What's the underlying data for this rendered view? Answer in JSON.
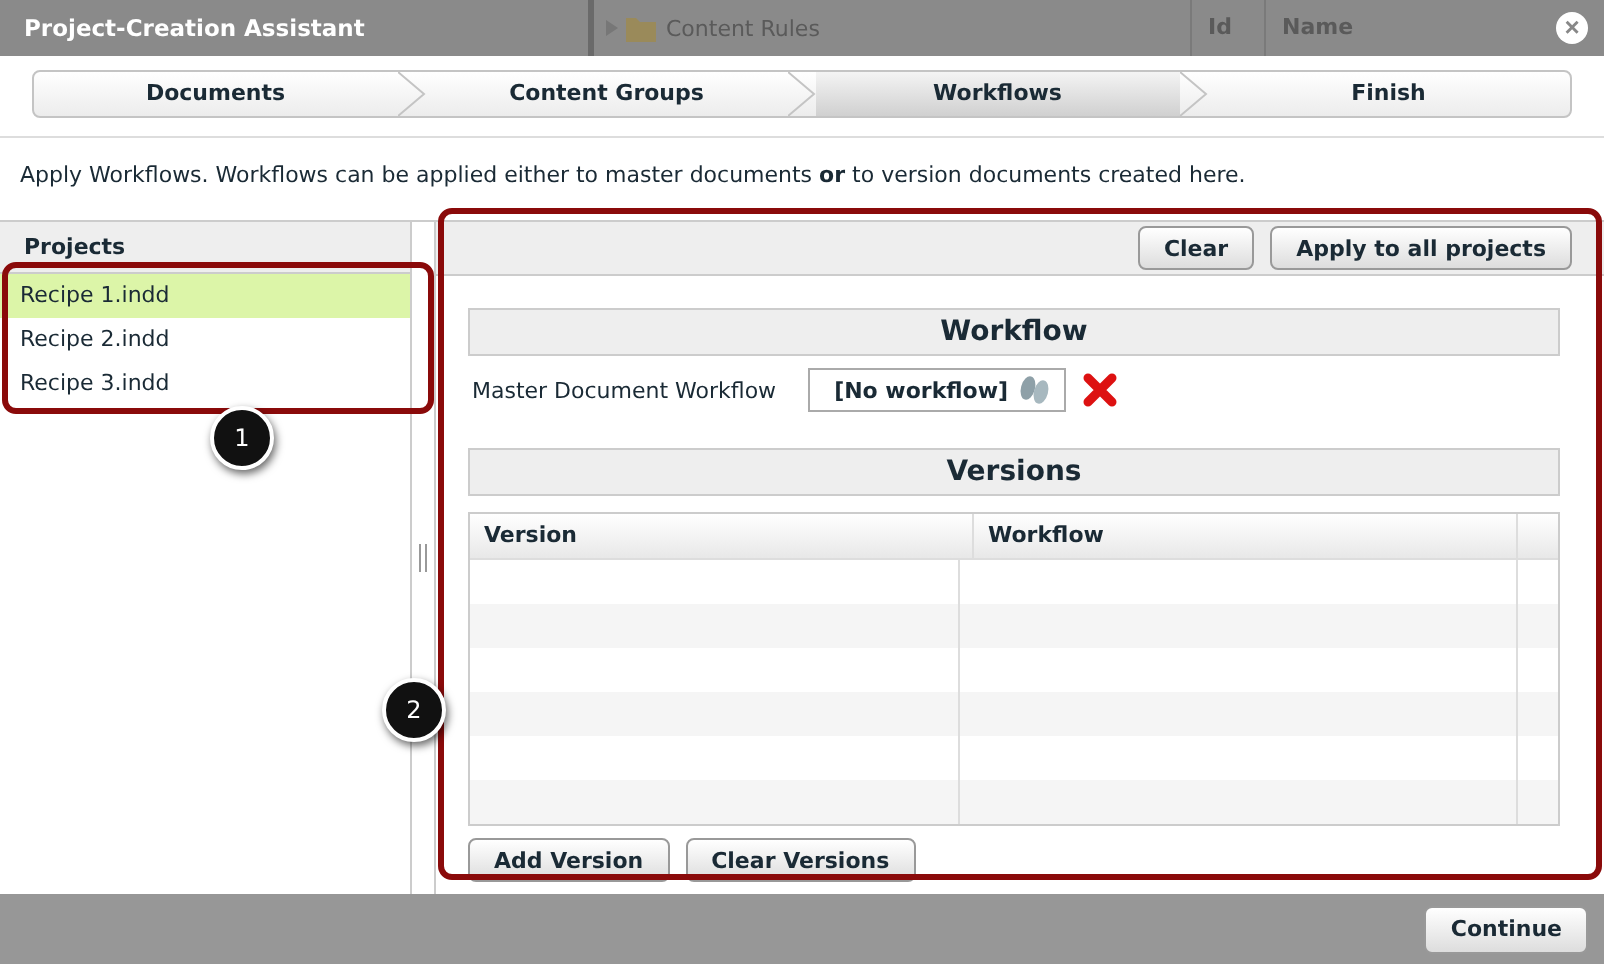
{
  "background_page": {
    "folder": "Content Rules",
    "columns": [
      "Id",
      "Name"
    ]
  },
  "window": {
    "title": "Project-Creation Assistant",
    "close": "×"
  },
  "steps": [
    {
      "label": "Documents",
      "selected": false
    },
    {
      "label": "Content Groups",
      "selected": false
    },
    {
      "label": "Workflows",
      "selected": true
    },
    {
      "label": "Finish",
      "selected": false
    }
  ],
  "description": "Apply Workflows. Workflows can be applied either to master documents **or** to version documents created here.",
  "projects": {
    "title": "Projects",
    "items": [
      {
        "label": "Recipe 1.indd",
        "selected": true
      },
      {
        "label": "Recipe 2.indd",
        "selected": false
      },
      {
        "label": "Recipe 3.indd",
        "selected": false
      }
    ]
  },
  "toolbar": {
    "buttons": [
      "Clear",
      "Apply to all projects"
    ]
  },
  "workflow": {
    "title": "Workflow",
    "label": "Master Document Workflow",
    "value": "[No workflow]"
  },
  "versions": {
    "title": "Versions",
    "columns": [
      "Version",
      "Workflow"
    ],
    "buttons": [
      "Add Version",
      "Clear Versions"
    ]
  },
  "callouts": [
    "1",
    "2"
  ],
  "footer": {
    "button": "Continue"
  }
}
